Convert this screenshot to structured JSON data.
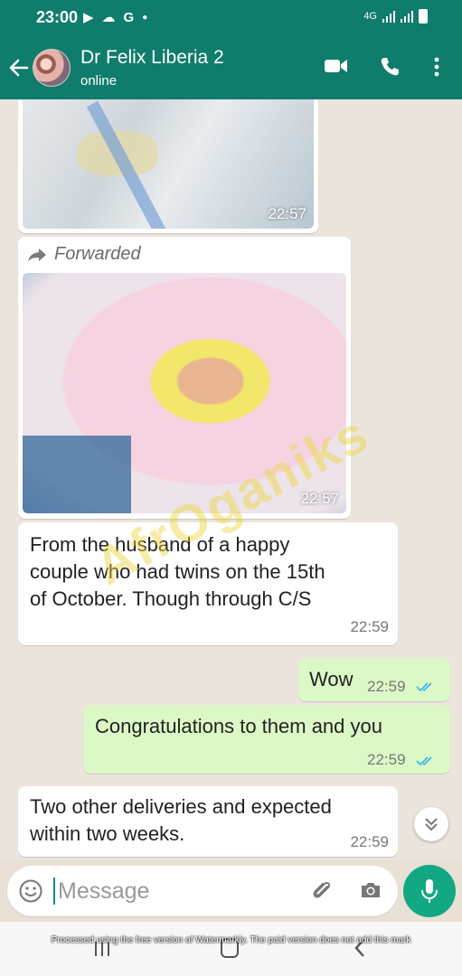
{
  "status_bar": {
    "time": "23:00",
    "network": "4G"
  },
  "header": {
    "contact_name": "Dr Felix Liberia 2",
    "contact_status": "online"
  },
  "messages": [
    {
      "type": "image",
      "direction": "in",
      "time": "22:57"
    },
    {
      "type": "image",
      "direction": "in",
      "forwarded_label": "Forwarded",
      "time": "22:57"
    },
    {
      "type": "text",
      "direction": "in",
      "lines": [
        "From the husband of a happy",
        "couple who had twins on the 15th",
        "of October. Though through C/S"
      ],
      "time": "22:59"
    },
    {
      "type": "text",
      "direction": "out",
      "text": "Wow",
      "time": "22:59",
      "read": true
    },
    {
      "type": "text",
      "direction": "out",
      "text": "Congratulations to them and you",
      "time": "22:59",
      "read": true
    },
    {
      "type": "text",
      "direction": "in",
      "lines": [
        "Two other deliveries and expected",
        "within two weeks."
      ],
      "time": "22:59"
    }
  ],
  "input": {
    "placeholder": "Message"
  },
  "overlay_logo": "AfrOganiks",
  "watermark": "Processed using the free version of Watermarkly. The paid version does not add this mark",
  "colors": {
    "header": "#0f7c6c",
    "outgoing_bubble": "#dcf8c6",
    "incoming_bubble": "#ffffff",
    "chat_background": "#ece5dd",
    "send_button": "#13a884",
    "read_ticks": "#34b7f1"
  },
  "icons": [
    "back-arrow-icon",
    "video-call-icon",
    "phone-icon",
    "more-options-icon",
    "forward-icon",
    "chevron-double-down-icon",
    "emoji-icon",
    "attach-icon",
    "camera-icon",
    "mic-icon"
  ]
}
